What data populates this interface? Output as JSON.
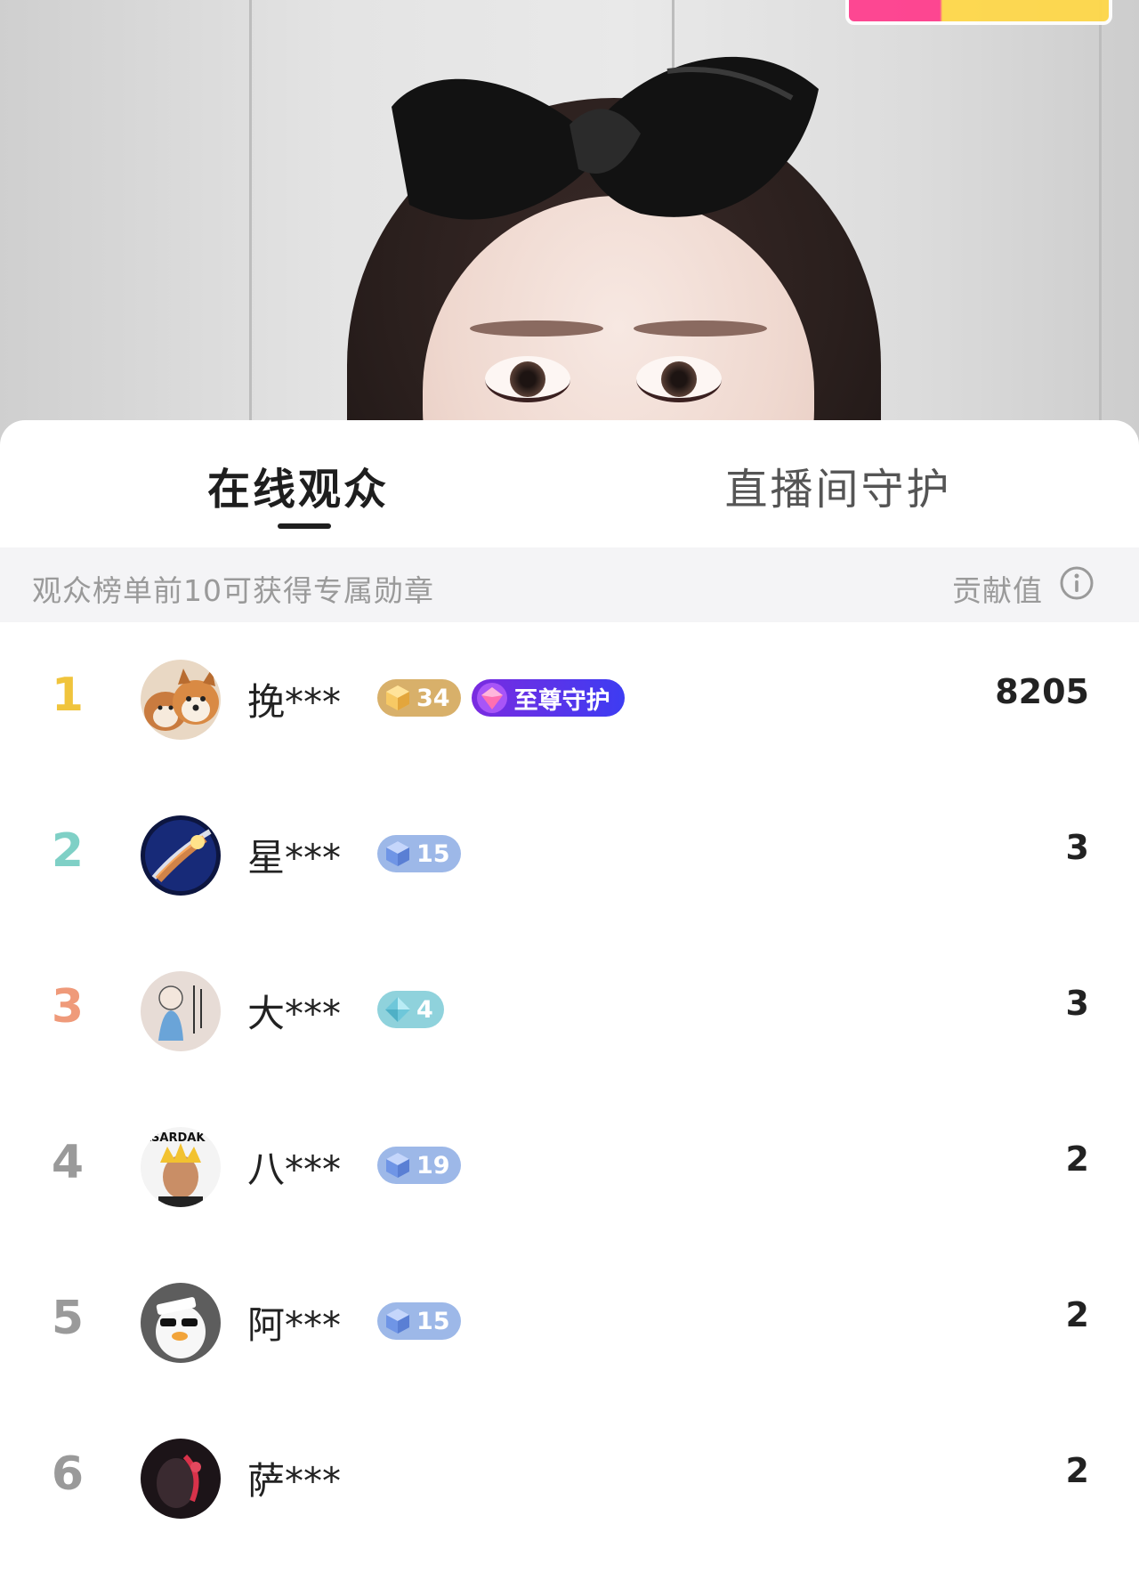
{
  "colors": {
    "rank_1": "#f0c43c",
    "rank_2": "#7fd0c6",
    "rank_3": "#ef9a7a",
    "rank_other": "#9a9a9a",
    "badge_gold": "#d8b06a",
    "badge_blue": "#9db8e8",
    "badge_teal": "#8fd2dc",
    "guard_purple": "#6a32e6"
  },
  "tabs": [
    {
      "label": "在线观众",
      "active": true
    },
    {
      "label": "直播间守护",
      "active": false
    }
  ],
  "notice": {
    "message": "观众榜单前10可获得专属勋章",
    "metric_label": "贡献值",
    "info_icon": "info-icon"
  },
  "viewers": [
    {
      "rank": "1",
      "name": "挽***",
      "level": "34",
      "level_tier": "gold",
      "guard": "至尊守护",
      "score": "8205",
      "avatar_icon": "shiba-dogs-avatar"
    },
    {
      "rank": "2",
      "name": "星***",
      "level": "15",
      "level_tier": "blue",
      "score": "3",
      "avatar_icon": "comet-avatar"
    },
    {
      "rank": "3",
      "name": "大***",
      "level": "4",
      "level_tier": "teal",
      "score": "3",
      "avatar_icon": "monk-drawing-avatar"
    },
    {
      "rank": "4",
      "name": "八***",
      "level": "19",
      "level_tier": "blue",
      "score": "2",
      "avatar_icon": "portrait-avatar",
      "avatar_text": "ASARDAK"
    },
    {
      "rank": "5",
      "name": "阿***",
      "level": "15",
      "level_tier": "blue",
      "score": "2",
      "avatar_icon": "cartoon-duck-avatar"
    },
    {
      "rank": "6",
      "name": "萨***",
      "score": "2",
      "avatar_icon": "dark-portrait-avatar"
    }
  ]
}
